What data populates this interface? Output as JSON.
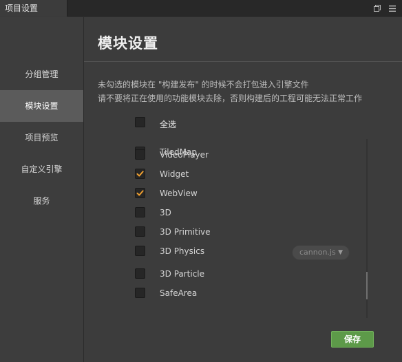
{
  "window": {
    "tab_title": "项目设置",
    "icons": [
      "restore-window-icon",
      "menu-icon"
    ]
  },
  "sidebar": {
    "items": [
      {
        "label": "分组管理",
        "active": false
      },
      {
        "label": "模块设置",
        "active": true
      },
      {
        "label": "项目预览",
        "active": false
      },
      {
        "label": "自定义引擎",
        "active": false
      },
      {
        "label": "服务",
        "active": false
      }
    ]
  },
  "main": {
    "title": "模块设置",
    "description_line1": "未勾选的模块在 \"构建发布\" 的时候不会打包进入引擎文件",
    "description_line2": "请不要将正在使用的功能模块去除，否则构建后的工程可能无法正常工作",
    "select_all_label": "全选",
    "select_all_checked": false,
    "modules": [
      {
        "label": "TiledMap",
        "checked": false
      },
      {
        "label": "VideoPlayer",
        "checked": false
      },
      {
        "label": "Widget",
        "checked": true
      },
      {
        "label": "WebView",
        "checked": true
      },
      {
        "label": "3D",
        "checked": false
      },
      {
        "label": "3D Primitive",
        "checked": false
      },
      {
        "label": "3D Physics",
        "checked": false
      },
      {
        "label": "3D Particle",
        "checked": false
      },
      {
        "label": "SafeArea",
        "checked": false
      }
    ],
    "physics_backend": {
      "selected": "cannon.js",
      "arrow": "▼"
    },
    "save_label": "保存"
  },
  "colors": {
    "accent_check": "#f0a030",
    "save_button": "#5d9a49",
    "active_nav": "#5b5b5b"
  }
}
